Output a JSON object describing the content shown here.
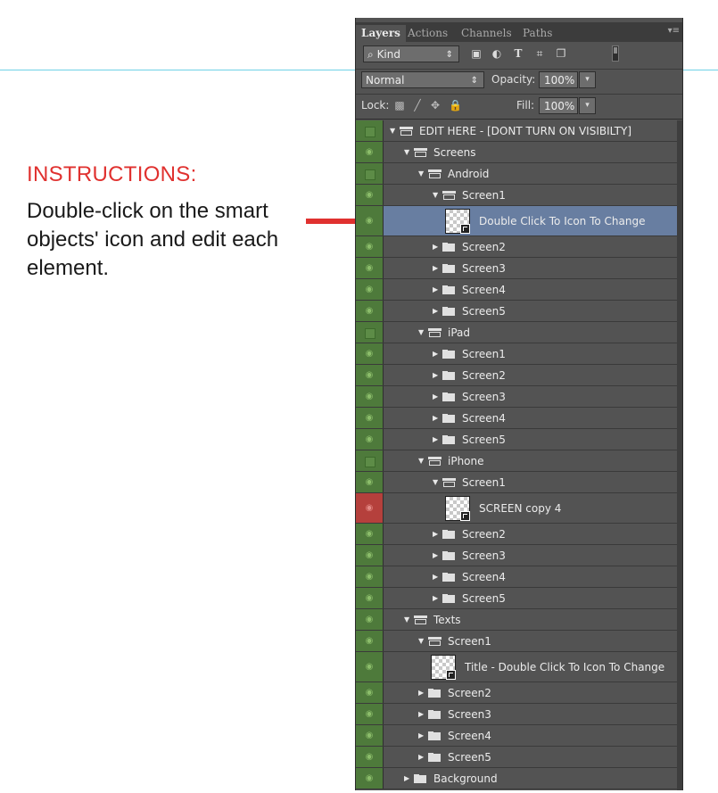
{
  "instructions": {
    "title": "INSTRUCTIONS:",
    "body": "Double-click on the smart objects' icon and edit each element."
  },
  "panel": {
    "tabs": [
      {
        "label": "Layers",
        "active": true
      },
      {
        "label": "Actions",
        "active": false
      },
      {
        "label": "Channels",
        "active": false
      },
      {
        "label": "Paths",
        "active": false
      }
    ],
    "filter": {
      "kind_label": "Kind",
      "icons": [
        "image-filter-icon",
        "adjustment-filter-icon",
        "type-filter-icon",
        "shape-filter-icon",
        "smart-object-filter-icon"
      ]
    },
    "blend_mode": "Normal",
    "opacity_label": "Opacity:",
    "opacity_value": "100%",
    "lock_label": "Lock:",
    "fill_label": "Fill:",
    "fill_value": "100%"
  },
  "layers": [
    {
      "name": "EDIT HERE - [DONT TURN ON VISIBILTY]",
      "type": "group",
      "expanded": true,
      "depth": 0,
      "visible": false
    },
    {
      "name": "Screens",
      "type": "group",
      "expanded": true,
      "depth": 1,
      "visible": true
    },
    {
      "name": "Android",
      "type": "group",
      "expanded": true,
      "depth": 2,
      "visible": false
    },
    {
      "name": "Screen1",
      "type": "group",
      "expanded": true,
      "depth": 3,
      "visible": true
    },
    {
      "name": "Double Click To Icon To Change",
      "type": "smart",
      "depth": 3,
      "visible": true,
      "selected": true
    },
    {
      "name": "Screen2",
      "type": "group",
      "expanded": false,
      "depth": 3,
      "visible": true
    },
    {
      "name": "Screen3",
      "type": "group",
      "expanded": false,
      "depth": 3,
      "visible": true
    },
    {
      "name": "Screen4",
      "type": "group",
      "expanded": false,
      "depth": 3,
      "visible": true
    },
    {
      "name": "Screen5",
      "type": "group",
      "expanded": false,
      "depth": 3,
      "visible": true
    },
    {
      "name": "iPad",
      "type": "group",
      "expanded": true,
      "depth": 2,
      "visible": false
    },
    {
      "name": "Screen1",
      "type": "group",
      "expanded": false,
      "depth": 3,
      "visible": true
    },
    {
      "name": "Screen2",
      "type": "group",
      "expanded": false,
      "depth": 3,
      "visible": true
    },
    {
      "name": "Screen3",
      "type": "group",
      "expanded": false,
      "depth": 3,
      "visible": true
    },
    {
      "name": "Screen4",
      "type": "group",
      "expanded": false,
      "depth": 3,
      "visible": true
    },
    {
      "name": "Screen5",
      "type": "group",
      "expanded": false,
      "depth": 3,
      "visible": true
    },
    {
      "name": "iPhone",
      "type": "group",
      "expanded": true,
      "depth": 2,
      "visible": false
    },
    {
      "name": "Screen1",
      "type": "group",
      "expanded": true,
      "depth": 3,
      "visible": true
    },
    {
      "name": "SCREEN copy 4",
      "type": "smart",
      "depth": 3,
      "visible": true,
      "red": true
    },
    {
      "name": "Screen2",
      "type": "group",
      "expanded": false,
      "depth": 3,
      "visible": true
    },
    {
      "name": "Screen3",
      "type": "group",
      "expanded": false,
      "depth": 3,
      "visible": true
    },
    {
      "name": "Screen4",
      "type": "group",
      "expanded": false,
      "depth": 3,
      "visible": true
    },
    {
      "name": "Screen5",
      "type": "group",
      "expanded": false,
      "depth": 3,
      "visible": true
    },
    {
      "name": "Texts",
      "type": "group",
      "expanded": true,
      "depth": 1,
      "visible": true
    },
    {
      "name": "Screen1",
      "type": "group",
      "expanded": true,
      "depth": 2,
      "visible": true
    },
    {
      "name": "Title - Double Click To Icon To Change",
      "type": "smart",
      "depth": 2,
      "visible": true
    },
    {
      "name": "Screen2",
      "type": "group",
      "expanded": false,
      "depth": 2,
      "visible": true
    },
    {
      "name": "Screen3",
      "type": "group",
      "expanded": false,
      "depth": 2,
      "visible": true
    },
    {
      "name": "Screen4",
      "type": "group",
      "expanded": false,
      "depth": 2,
      "visible": true
    },
    {
      "name": "Screen5",
      "type": "group",
      "expanded": false,
      "depth": 2,
      "visible": true
    },
    {
      "name": "Background",
      "type": "group",
      "expanded": false,
      "depth": 1,
      "visible": true
    }
  ]
}
